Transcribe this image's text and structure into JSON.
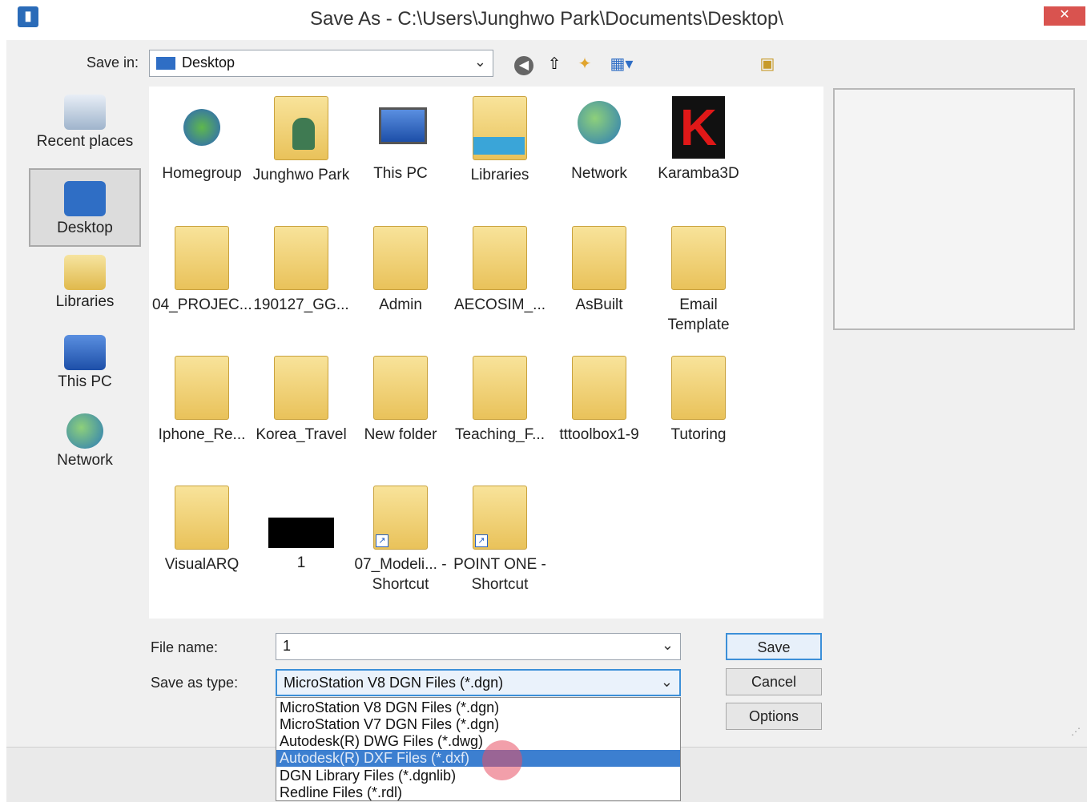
{
  "window": {
    "title": "Save As - C:\\Users\\Junghwo Park\\Documents\\Desktop\\",
    "close_glyph": "✕"
  },
  "toolbar": {
    "save_in_label": "Save in:",
    "save_in_value": "Desktop",
    "icons": [
      "back-icon",
      "up-folder-icon",
      "new-folder-icon",
      "view-menu-icon",
      "network-icon"
    ]
  },
  "places": [
    {
      "label": "Recent places",
      "icon": "recent-places-icon"
    },
    {
      "label": "Desktop",
      "icon": "desktop-icon",
      "selected": true
    },
    {
      "label": "Libraries",
      "icon": "libraries-icon"
    },
    {
      "label": "This PC",
      "icon": "this-pc-icon"
    },
    {
      "label": "Network",
      "icon": "network-icon"
    }
  ],
  "files": [
    {
      "name": "Homegroup",
      "kind": "homegroup"
    },
    {
      "name": "Junghwo Park",
      "kind": "user"
    },
    {
      "name": "This PC",
      "kind": "pc"
    },
    {
      "name": "Libraries",
      "kind": "libraries"
    },
    {
      "name": "Network",
      "kind": "network"
    },
    {
      "name": "Karamba3D",
      "kind": "app-shortcut"
    },
    {
      "name": "04_PROJEC...",
      "kind": "folder"
    },
    {
      "name": "190127_GG...",
      "kind": "folder"
    },
    {
      "name": "Admin",
      "kind": "folder"
    },
    {
      "name": "AECOSIM_...",
      "kind": "folder"
    },
    {
      "name": "AsBuilt",
      "kind": "folder"
    },
    {
      "name": "Email Template",
      "kind": "folder"
    },
    {
      "name": "Iphone_Re...",
      "kind": "folder"
    },
    {
      "name": "Korea_Travel",
      "kind": "folder"
    },
    {
      "name": "New folder",
      "kind": "folder"
    },
    {
      "name": "Teaching_F...",
      "kind": "folder"
    },
    {
      "name": "tttoolbox1-9",
      "kind": "folder"
    },
    {
      "name": "Tutoring",
      "kind": "folder"
    },
    {
      "name": "VisualARQ",
      "kind": "folder"
    },
    {
      "name": "1",
      "kind": "image"
    },
    {
      "name": "07_Modeli... - Shortcut",
      "kind": "folder-shortcut"
    },
    {
      "name": "POINT ONE - Shortcut",
      "kind": "folder-shortcut"
    }
  ],
  "form": {
    "file_name_label": "File name:",
    "file_name_value": "1",
    "save_type_label": "Save as type:",
    "save_type_value": "MicroStation V8 DGN Files (*.dgn)"
  },
  "buttons": {
    "save": "Save",
    "cancel": "Cancel",
    "options": "Options"
  },
  "dropdown": {
    "options": [
      "MicroStation V8 DGN Files (*.dgn)",
      "MicroStation V7 DGN Files (*.dgn)",
      "Autodesk(R) DWG Files (*.dwg)",
      "Autodesk(R) DXF Files (*.dxf)",
      "DGN Library Files (*.dgnlib)",
      "Redline Files (*.rdl)"
    ],
    "highlighted": "Autodesk(R) DXF Files (*.dxf)"
  },
  "colors": {
    "accent": "#3c7fd0",
    "close": "#d9534f",
    "folder": "#e9c25a"
  }
}
